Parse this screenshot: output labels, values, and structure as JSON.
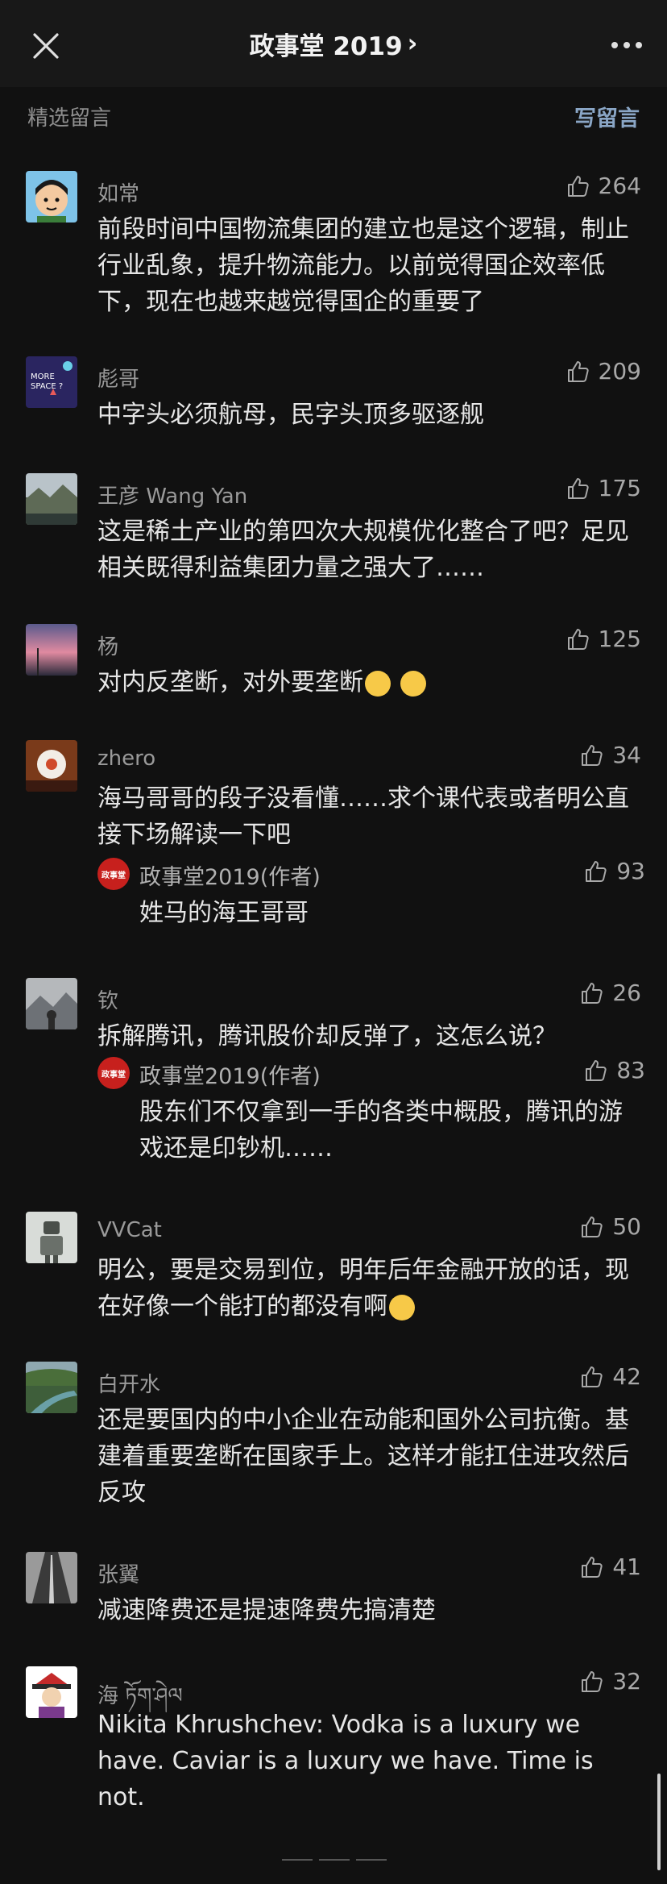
{
  "header": {
    "title": "政事堂 2019",
    "title_chevron": "›"
  },
  "section": {
    "label": "精选留言",
    "write": "写留言"
  },
  "comments": [
    {
      "name": "如常",
      "likes": "264",
      "text": "前段时间中国物流集团的建立也是这个逻辑，制止行业乱象，提升物流能力。以前觉得国企效率低下，现在也越来越觉得国企的重要了",
      "avatar": "cartoon-boy-avatar"
    },
    {
      "name": "彪哥",
      "likes": "209",
      "text": "中字头必须航母，民字头顶多驱逐舰",
      "avatar": "space-poster-avatar",
      "avatar_text_1": "MORE",
      "avatar_text_2": "SPACE ?"
    },
    {
      "name": "王彦 Wang Yan",
      "likes": "175",
      "text": "这是稀土产业的第四次大规模优化整合了吧？足见相关既得利益集团力量之强大了……",
      "avatar": "landscape-avatar"
    },
    {
      "name": "杨",
      "likes": "125",
      "text": "对内反垄断，对外要垄断",
      "avatar": "sunset-avatar"
    },
    {
      "name": "zhero",
      "likes": "34",
      "text": "海马哥哥的段子没看懂……求个课代表或者明公直接下场解读一下吧",
      "avatar": "flower-avatar",
      "reply": {
        "name": "政事堂2019(作者)",
        "likes": "93",
        "text": "姓马的海王哥哥",
        "badge": "政事堂"
      }
    },
    {
      "name": "钦",
      "likes": "26",
      "text": "拆解腾讯，腾讯股价却反弹了，这怎么说？",
      "avatar": "mountain-avatar",
      "reply": {
        "name": "政事堂2019(作者)",
        "likes": "83",
        "text": "股东们不仅拿到一手的各类中概股，腾讯的游戏还是印钞机……",
        "badge": "政事堂"
      }
    },
    {
      "name": "VVCat",
      "likes": "50",
      "text": "明公，要是交易到位，明年后年金融开放的话，现在好像一个能打的都没有啊",
      "avatar": "robot-avatar"
    },
    {
      "name": "白开水",
      "likes": "42",
      "text": "还是要国内的中小企业在动能和国外公司抗衡。基建着重要垄断在国家手上。这样才能扛住进攻然后反攻",
      "avatar": "river-avatar"
    },
    {
      "name": "张翼",
      "likes": "41",
      "text": "减速降费还是提速降费先搞清楚",
      "avatar": "road-avatar"
    },
    {
      "name": "海 ཏོག་ཤེལ",
      "likes": "32",
      "text": "Nikita Khrushchev: Vodka is a luxury we have. Caviar is a luxury we have. Time is not.",
      "avatar": "guard-avatar"
    }
  ],
  "colors": {
    "background": "#111111",
    "accent_link": "#8aa6c6",
    "author_badge": "#c7201d"
  }
}
